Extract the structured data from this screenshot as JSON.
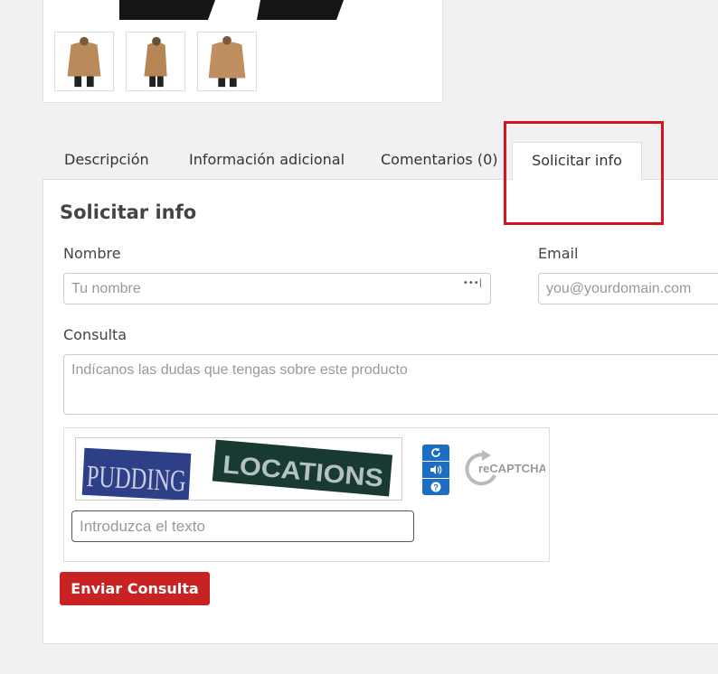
{
  "tabs": [
    {
      "label": "Descripción"
    },
    {
      "label": "Información adicional"
    },
    {
      "label": "Comentarios (0)"
    },
    {
      "label": "Solicitar info",
      "active": true
    }
  ],
  "form": {
    "title": "Solicitar info",
    "name_label": "Nombre",
    "name_placeholder": "Tu nombre",
    "name_dots": "•••|",
    "email_label": "Email",
    "email_placeholder": "you@yourdomain.com",
    "query_label": "Consulta",
    "query_placeholder": "Indícanos las dudas que tengas sobre este producto",
    "submit_label": "Enviar Consulta"
  },
  "captcha": {
    "word1": "PUDDING",
    "word2": "LOCATIONS",
    "input_placeholder": "Introduzca el texto",
    "logo_text": "reCAPTCHA™",
    "buttons": [
      "refresh-icon",
      "audio-icon",
      "help-icon"
    ]
  },
  "colors": {
    "accent_red": "#c92222",
    "highlight_red": "#d0161c",
    "captcha_blue": "#1b6ec2"
  }
}
